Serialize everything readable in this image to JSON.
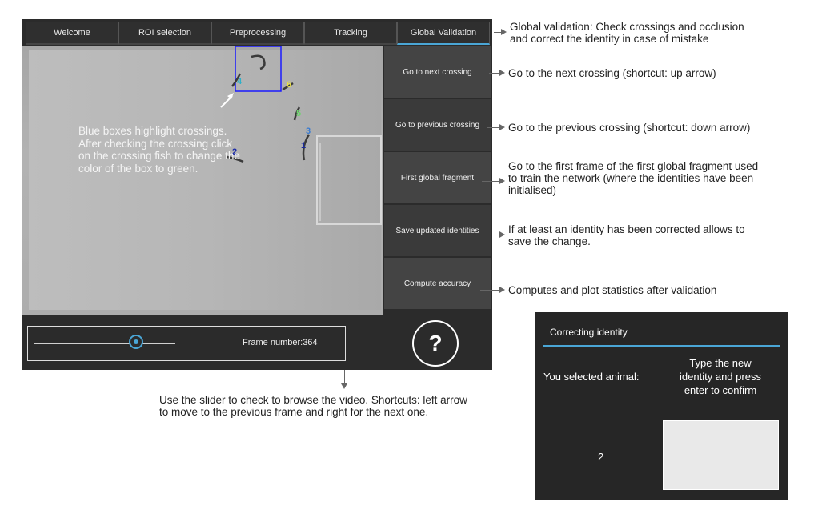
{
  "tabs": [
    {
      "label": "Welcome"
    },
    {
      "label": "ROI selection"
    },
    {
      "label": "Preprocessing"
    },
    {
      "label": "Tracking"
    },
    {
      "label": "Global Validation"
    }
  ],
  "side_buttons": [
    {
      "label": "Go to next crossing"
    },
    {
      "label": "Go to previous crossing"
    },
    {
      "label": "First global fragment"
    },
    {
      "label": "Save updated identities"
    },
    {
      "label": "Compute accuracy"
    }
  ],
  "video": {
    "overlay_lines": [
      "Blue boxes highlight crossings.",
      "After checking the crossing click",
      "on the crossing fish to change the",
      "color of the box to green."
    ],
    "identity_labels": [
      {
        "text": "1",
        "color": "#1a2a9a"
      },
      {
        "text": "2",
        "color": "#1a2aa8"
      },
      {
        "text": "3",
        "color": "#3a7bd0"
      },
      {
        "text": "4",
        "color": "#2fb0c8"
      },
      {
        "text": "5",
        "color": "#6ed36e"
      },
      {
        "text": "6",
        "color": "#e8e040"
      }
    ]
  },
  "bottom": {
    "frame_label": "Frame number:364",
    "slider_fraction": 0.7,
    "help_label": "?"
  },
  "annotations": {
    "global_validation": [
      "Global validation: Check crossings and occlusion",
      "and correct the identity in case of mistake"
    ],
    "next_crossing": [
      "Go to the next crossing (shortcut: up arrow)"
    ],
    "previous_crossing": [
      "Go to the previous crossing (shortcut: down arrow)"
    ],
    "first_fragment": [
      "Go to the first frame of the first global fragment used",
      "to train the network (where the identities have been",
      "initialised)"
    ],
    "save_identities": [
      "If at least an identity has been corrected allows to",
      "save the change."
    ],
    "compute_accuracy": [
      "Computes and plot statistics after validation"
    ],
    "slider": [
      "Use the slider to check to browse the video. Shortcuts: left arrow",
      "to move to the previous  frame and right for the next one."
    ]
  },
  "dialog": {
    "title": "Correcting identity",
    "label": "You selected animal:",
    "instruction": [
      "Type the new",
      "identity and press",
      "enter to confirm"
    ],
    "value": "2",
    "input_value": ""
  },
  "colors": {
    "accent": "#4aa6d6",
    "crossing_box": "#1a1aff"
  }
}
